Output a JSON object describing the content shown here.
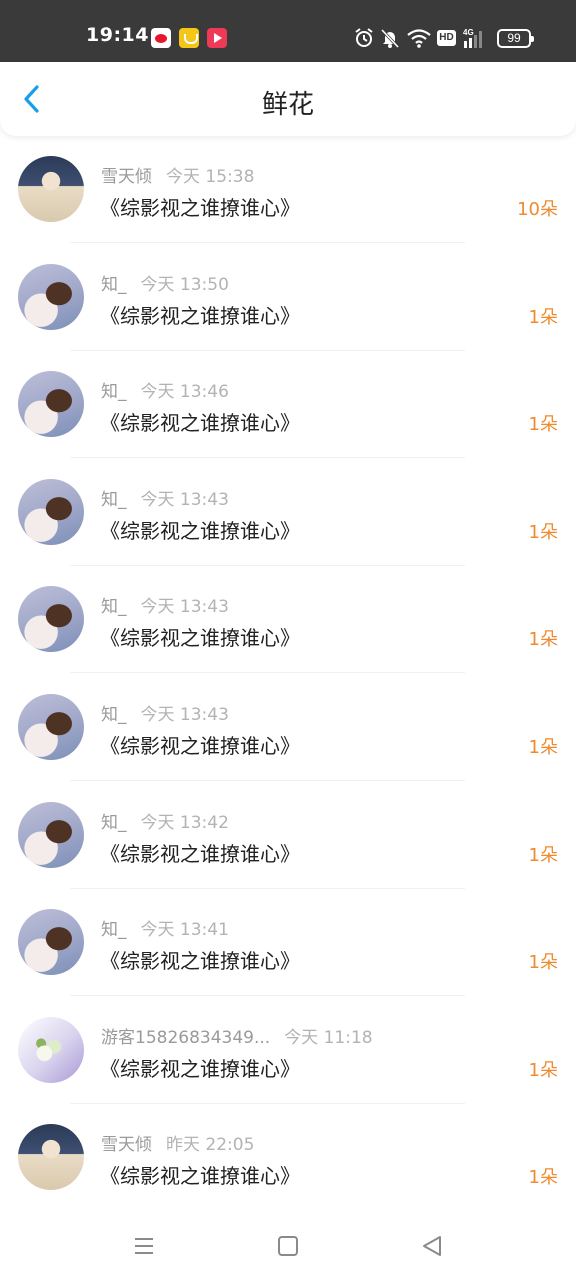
{
  "status_bar": {
    "time": "19:14",
    "notification_icons": [
      "weibo-icon",
      "yellow-app-icon",
      "video-app-icon"
    ],
    "system_icons": [
      "alarm-icon",
      "mute-icon",
      "wifi-icon",
      "hd-icon",
      "signal-4g-icon",
      "battery-icon"
    ],
    "hd_label": "HD",
    "network_label": "4G",
    "battery": "99"
  },
  "header": {
    "back_icon": "chevron-left-icon",
    "title": "鲜花"
  },
  "colors": {
    "accent": "#1a9ee8",
    "count": "#f08a2e",
    "status_bar_bg": "#3a3a3a"
  },
  "records": [
    {
      "user": "雪天倾",
      "time": "今天 15:38",
      "book": "《综影视之谁撩谁心》",
      "count": "10朵"
    },
    {
      "user": "知_",
      "time": "今天 13:50",
      "book": "《综影视之谁撩谁心》",
      "count": "1朵"
    },
    {
      "user": "知_",
      "time": "今天 13:46",
      "book": "《综影视之谁撩谁心》",
      "count": "1朵"
    },
    {
      "user": "知_",
      "time": "今天 13:43",
      "book": "《综影视之谁撩谁心》",
      "count": "1朵"
    },
    {
      "user": "知_",
      "time": "今天 13:43",
      "book": "《综影视之谁撩谁心》",
      "count": "1朵"
    },
    {
      "user": "知_",
      "time": "今天 13:43",
      "book": "《综影视之谁撩谁心》",
      "count": "1朵"
    },
    {
      "user": "知_",
      "time": "今天 13:42",
      "book": "《综影视之谁撩谁心》",
      "count": "1朵"
    },
    {
      "user": "知_",
      "time": "今天 13:41",
      "book": "《综影视之谁撩谁心》",
      "count": "1朵"
    },
    {
      "user": "游客15826834349...",
      "time": "今天 11:18",
      "book": "《综影视之谁撩谁心》",
      "count": "1朵"
    },
    {
      "user": "雪天倾",
      "time": "昨天 22:05",
      "book": "《综影视之谁撩谁心》",
      "count": "1朵"
    }
  ],
  "nav_bar": {
    "icons": [
      "menu-icon",
      "home-square-icon",
      "back-triangle-icon"
    ]
  }
}
